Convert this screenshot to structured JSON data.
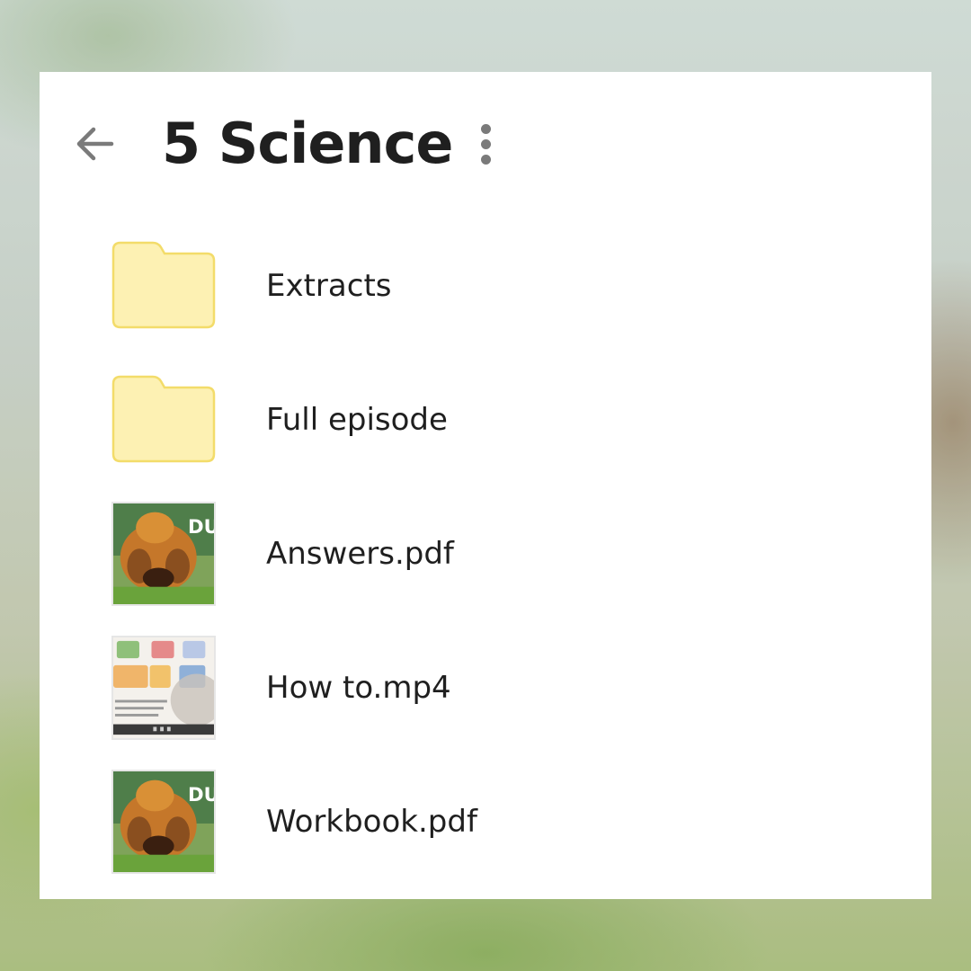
{
  "header": {
    "title": "5 Science",
    "back_icon": "arrow-left-icon",
    "more_icon": "more-vertical-icon"
  },
  "colors": {
    "panel": "#ffffff",
    "text": "#1f1f1f",
    "icon": "#7a7a7a",
    "folder_fill": "#fdf1b3",
    "folder_stroke": "#f3dc6a"
  },
  "files": [
    {
      "name": "Extracts",
      "kind": "folder",
      "icon": "folder-icon"
    },
    {
      "name": "Full episode",
      "kind": "folder",
      "icon": "folder-icon"
    },
    {
      "name": "Answers.pdf",
      "kind": "pdf",
      "icon": "pdf-thumbnail",
      "thumb_text": "DU DA"
    },
    {
      "name": "How to.mp4",
      "kind": "video",
      "icon": "video-thumbnail"
    },
    {
      "name": "Workbook.pdf",
      "kind": "pdf",
      "icon": "pdf-thumbnail",
      "thumb_text": "DU DA"
    }
  ]
}
